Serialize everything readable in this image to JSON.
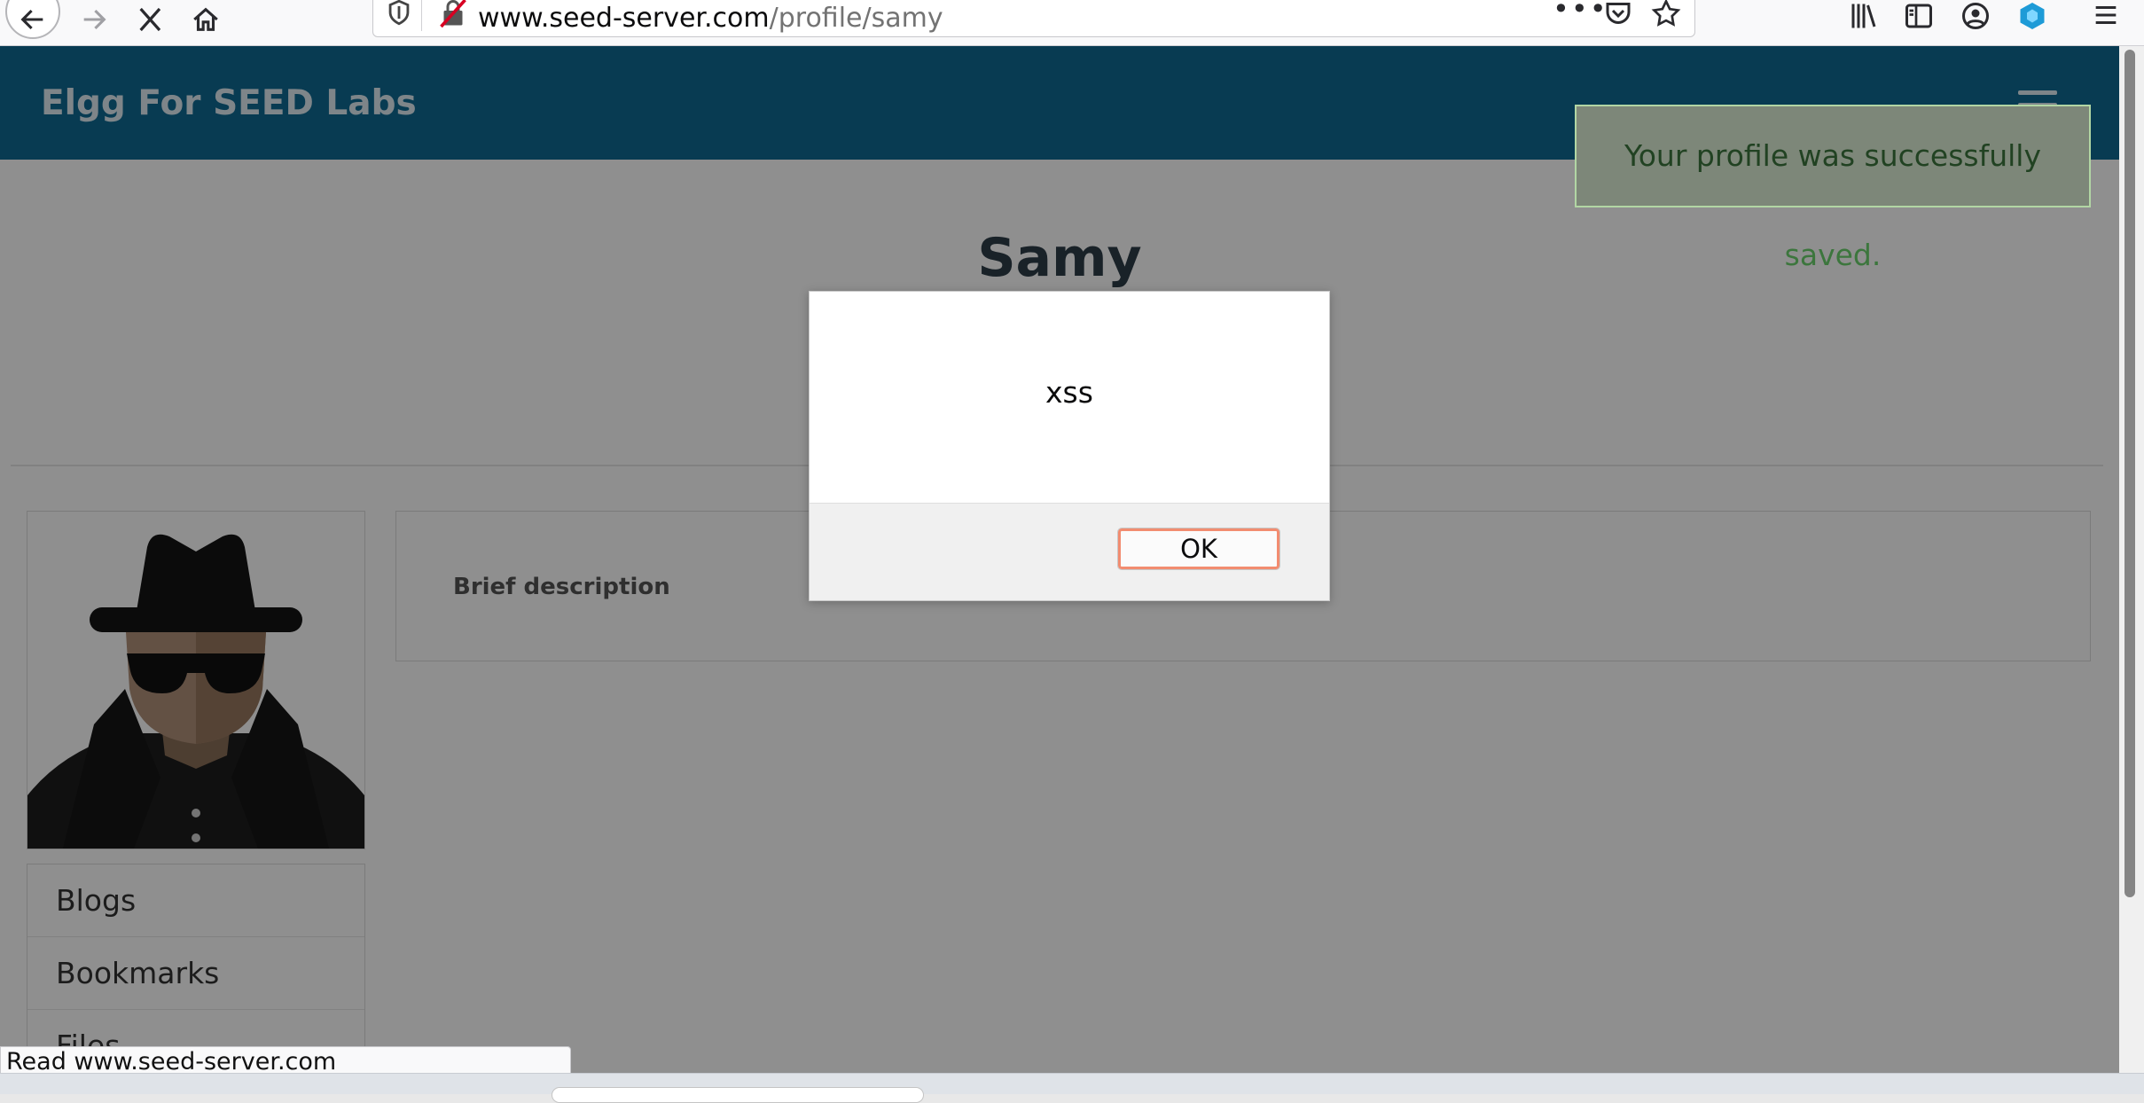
{
  "browser": {
    "url_host": "www.seed-server.com",
    "url_path": "/profile/samy",
    "status_text": "Read www.seed-server.com"
  },
  "site": {
    "title": "Elgg For SEED Labs"
  },
  "flash": {
    "message": "Your profile was successfully saved."
  },
  "profile": {
    "name": "Samy",
    "brief_description_label": "Brief description",
    "menu": [
      {
        "label": "Blogs"
      },
      {
        "label": "Bookmarks"
      },
      {
        "label": "Files"
      }
    ]
  },
  "dialog": {
    "message": "xss",
    "ok_label": "OK"
  },
  "colors": {
    "header": "#0f6a93",
    "flash_bg": "#dff0d8",
    "flash_text": "#3c763d",
    "ok_border": "#f28c70"
  }
}
